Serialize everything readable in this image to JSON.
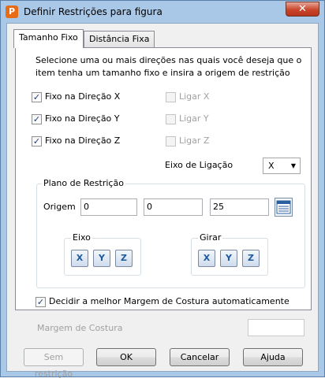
{
  "window": {
    "title": "Definir Restrições para figura",
    "app_icon_letter": "P",
    "close_glyph": "✕"
  },
  "tabs": [
    {
      "label": "Tamanho Fixo"
    },
    {
      "label": "Distância Fixa"
    }
  ],
  "instructions": "Selecione uma ou mais direções nas quais você deseja que o item tenha um tamanho fixo e insira a origem de restrição",
  "fixed": [
    {
      "label": "Fixo na Direção X",
      "checked": true
    },
    {
      "label": "Fixo na Direção Y",
      "checked": true
    },
    {
      "label": "Fixo na Direção Z",
      "checked": true
    }
  ],
  "link": [
    {
      "label": "Ligar X",
      "checked": false
    },
    {
      "label": "Ligar Y",
      "checked": false
    },
    {
      "label": "Ligar Z",
      "checked": false
    }
  ],
  "link_axis": {
    "label": "Eixo de Ligação",
    "value": "X",
    "arrow": "▼"
  },
  "plane": {
    "title": "Plano de Restrição",
    "origin_label": "Origem",
    "origin": [
      "0",
      "0",
      "25"
    ],
    "pick_icon": "table-icon"
  },
  "axis_group": {
    "title": "Eixo",
    "buttons": [
      "X",
      "Y",
      "Z"
    ]
  },
  "rotate_group": {
    "title": "Girar",
    "buttons": [
      "X",
      "Y",
      "Z"
    ]
  },
  "seam": {
    "label": "Decidir a melhor Margem de Costura automaticamente",
    "checked": true,
    "check_glyph": "✓"
  },
  "margin": {
    "label": "Margem de Costura",
    "value": ""
  },
  "buttons": {
    "no_restriction": "Sem restrição",
    "ok": "OK",
    "cancel": "Cancelar",
    "help": "Ajuda"
  },
  "colors": {
    "window_frame": "#a9c7e6",
    "accent": "#1c5a9e",
    "close": "#c9462c"
  }
}
